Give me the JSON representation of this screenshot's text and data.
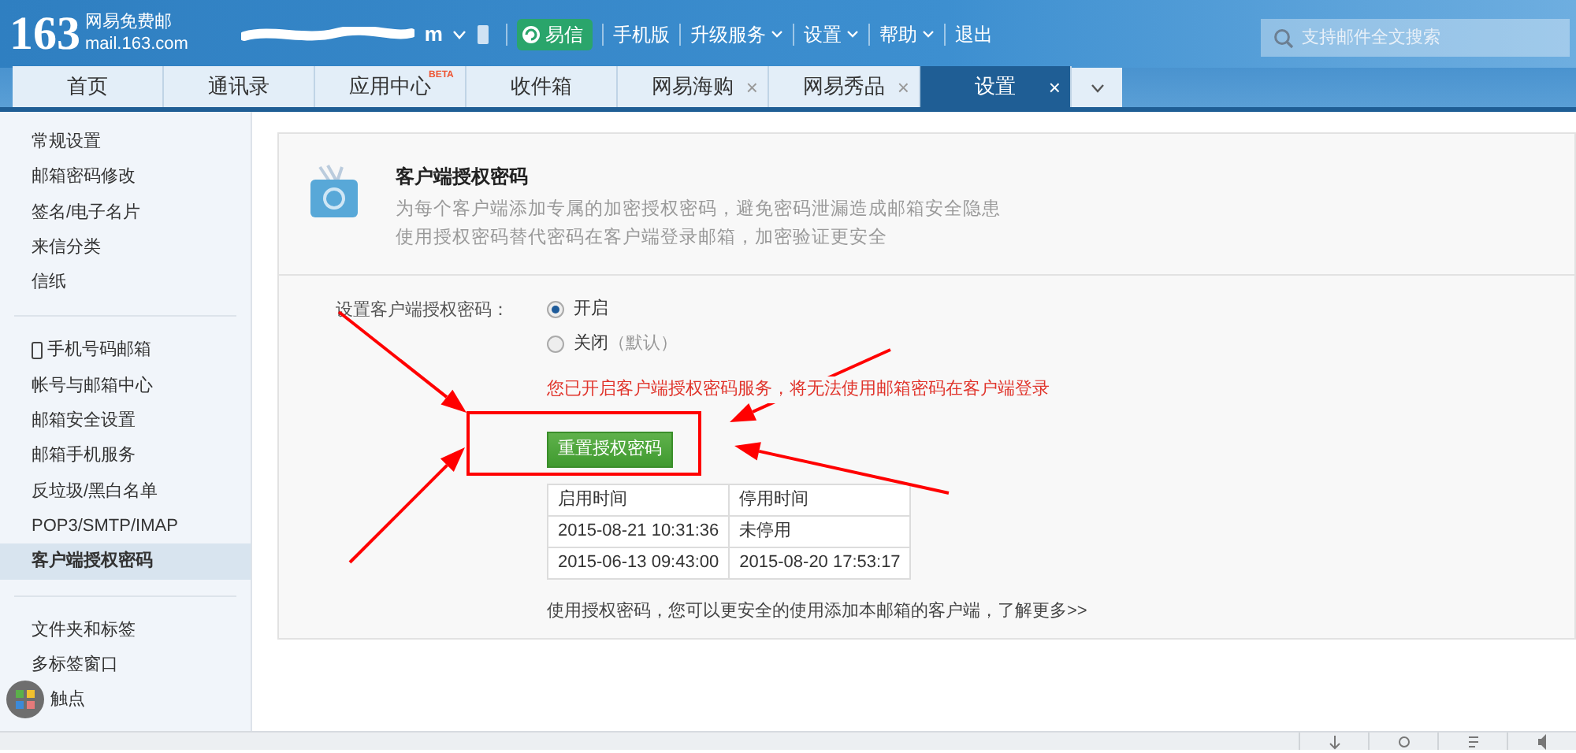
{
  "logo": {
    "number": "163",
    "name": "网易免费邮",
    "domain": "mail.163.com"
  },
  "account": {
    "visible_text": "m"
  },
  "top_links": [
    {
      "label": "易信",
      "kind": "badge"
    },
    {
      "label": "手机版",
      "kind": "link"
    },
    {
      "label": "升级服务",
      "kind": "menu"
    },
    {
      "label": "设置",
      "kind": "menu"
    },
    {
      "label": "帮助",
      "kind": "menu"
    },
    {
      "label": "退出",
      "kind": "link"
    }
  ],
  "search": {
    "placeholder": "支持邮件全文搜索"
  },
  "tabs": [
    {
      "label": "首页",
      "selected": false
    },
    {
      "label": "通讯录",
      "selected": false
    },
    {
      "label": "应用中心",
      "badge": "BETA",
      "selected": false
    },
    {
      "label": "收件箱",
      "selected": false
    },
    {
      "label": "网易海购",
      "selected": false,
      "close": "×"
    },
    {
      "label": "网易秀品",
      "selected": false,
      "close": "×"
    },
    {
      "label": "设置",
      "selected": true,
      "close": "×"
    }
  ],
  "sidebar": {
    "groups": [
      {
        "items": [
          {
            "label": "常规设置",
            "selected": false
          },
          {
            "label": "邮箱密码修改",
            "selected": false
          },
          {
            "label": "签名/电子名片",
            "selected": false
          },
          {
            "label": "来信分类",
            "selected": false
          },
          {
            "label": "信纸",
            "selected": false
          }
        ]
      },
      {
        "items": [
          {
            "label": "手机号码邮箱",
            "kind": "phone",
            "selected": false
          },
          {
            "label": "帐号与邮箱中心",
            "selected": false
          },
          {
            "label": "邮箱安全设置",
            "selected": false
          },
          {
            "label": "邮箱手机服务",
            "selected": false
          },
          {
            "label": "反垃圾/黑白名单",
            "selected": false
          },
          {
            "label": "POP3/SMTP/IMAP",
            "selected": false
          },
          {
            "label": "客户端授权密码",
            "selected": true
          }
        ]
      },
      {
        "items": [
          {
            "label": "文件夹和标签",
            "selected": false
          },
          {
            "label": "多标签窗口",
            "selected": false
          },
          {
            "label": "触点",
            "kind": "covered",
            "selected": false
          }
        ]
      }
    ]
  },
  "panel": {
    "title": "客户端授权密码",
    "description": [
      "为每个客户端添加专属的加密授权密码，避免密码泄漏造成邮箱安全隐患",
      "使用授权密码替代密码在客户端登录邮箱，加密验证更安全"
    ],
    "setting_label": "设置客户端授权密码：",
    "options": [
      {
        "label": "开启",
        "selected": true
      },
      {
        "label": "关闭",
        "note": "（默认）",
        "selected": false
      }
    ],
    "warning": "您已开启客户端授权密码服务，将无法使用邮箱密码在客户端登录",
    "reset_button": "重置授权密码",
    "history": {
      "columns": [
        "启用时间",
        "停用时间"
      ],
      "rows": [
        [
          "2015-08-21 10:31:36",
          "未停用"
        ],
        [
          "2015-06-13 09:43:00",
          "2015-08-20 17:53:17"
        ]
      ]
    },
    "footer": {
      "text": "使用授权密码，您可以更安全的使用添加本邮箱的客户端，",
      "link": "了解更多>>"
    }
  }
}
